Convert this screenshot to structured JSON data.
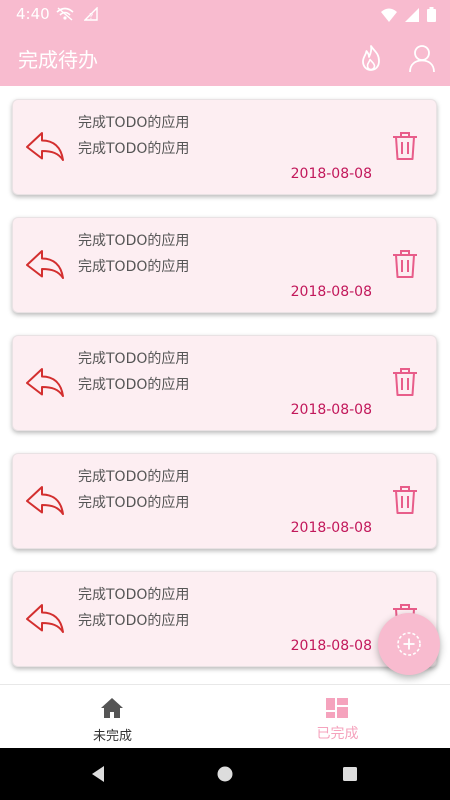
{
  "status_bar": {
    "time": "4:40",
    "icons": [
      "wifi-off-icon",
      "signal-unknown-icon",
      "wifi-icon",
      "cell-signal-icon",
      "battery-icon"
    ]
  },
  "app_bar": {
    "title": "完成待办",
    "actions": [
      "fire-icon",
      "user-icon"
    ]
  },
  "todo_list": {
    "items": [
      {
        "title": "完成TODO的应用",
        "content": "完成TODO的应用",
        "date": "2018-08-08"
      },
      {
        "title": "完成TODO的应用",
        "content": "完成TODO的应用",
        "date": "2018-08-08"
      },
      {
        "title": "完成TODO的应用",
        "content": "完成TODO的应用",
        "date": "2018-08-08"
      },
      {
        "title": "完成TODO的应用",
        "content": "完成TODO的应用",
        "date": "2018-08-08"
      },
      {
        "title": "完成TODO的应用",
        "content": "完成TODO的应用",
        "date": "2018-08-08"
      }
    ],
    "item_icons": {
      "restore": "undo-arrow-icon",
      "delete": "trash-icon"
    }
  },
  "fab": {
    "icon": "add-circle-icon"
  },
  "bottom_nav": {
    "selected": "completed",
    "items": [
      {
        "label": "未完成",
        "icon": "home-icon"
      },
      {
        "label": "已完成",
        "icon": "dashboard-icon"
      }
    ]
  },
  "colors": {
    "primary": "#f8bbcf",
    "card_background": "#fdeef2",
    "date_text": "#c2185b",
    "restore_icon": "#d32f2f",
    "delete_icon": "#e85d8a",
    "nav_selected": "#f5a3bd"
  }
}
